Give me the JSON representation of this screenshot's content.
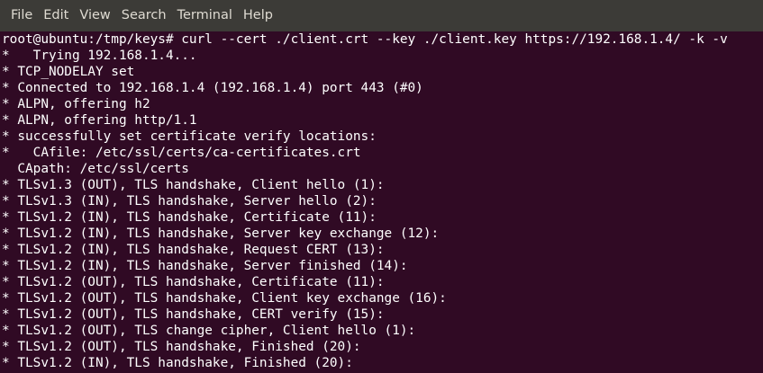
{
  "menu": {
    "items": [
      "File",
      "Edit",
      "View",
      "Search",
      "Terminal",
      "Help"
    ]
  },
  "terminal": {
    "lines": [
      "root@ubuntu:/tmp/keys# curl --cert ./client.crt --key ./client.key https://192.168.1.4/ -k -v",
      "*   Trying 192.168.1.4...",
      "* TCP_NODELAY set",
      "* Connected to 192.168.1.4 (192.168.1.4) port 443 (#0)",
      "* ALPN, offering h2",
      "* ALPN, offering http/1.1",
      "* successfully set certificate verify locations:",
      "*   CAfile: /etc/ssl/certs/ca-certificates.crt",
      "  CApath: /etc/ssl/certs",
      "* TLSv1.3 (OUT), TLS handshake, Client hello (1):",
      "* TLSv1.3 (IN), TLS handshake, Server hello (2):",
      "* TLSv1.2 (IN), TLS handshake, Certificate (11):",
      "* TLSv1.2 (IN), TLS handshake, Server key exchange (12):",
      "* TLSv1.2 (IN), TLS handshake, Request CERT (13):",
      "* TLSv1.2 (IN), TLS handshake, Server finished (14):",
      "* TLSv1.2 (OUT), TLS handshake, Certificate (11):",
      "* TLSv1.2 (OUT), TLS handshake, Client key exchange (16):",
      "* TLSv1.2 (OUT), TLS handshake, CERT verify (15):",
      "* TLSv1.2 (OUT), TLS change cipher, Client hello (1):",
      "* TLSv1.2 (OUT), TLS handshake, Finished (20):",
      "* TLSv1.2 (IN), TLS handshake, Finished (20):"
    ]
  },
  "colors": {
    "terminal_bg": "#300a24",
    "menubar_bg": "#3c3b37",
    "text": "#ffffff"
  }
}
